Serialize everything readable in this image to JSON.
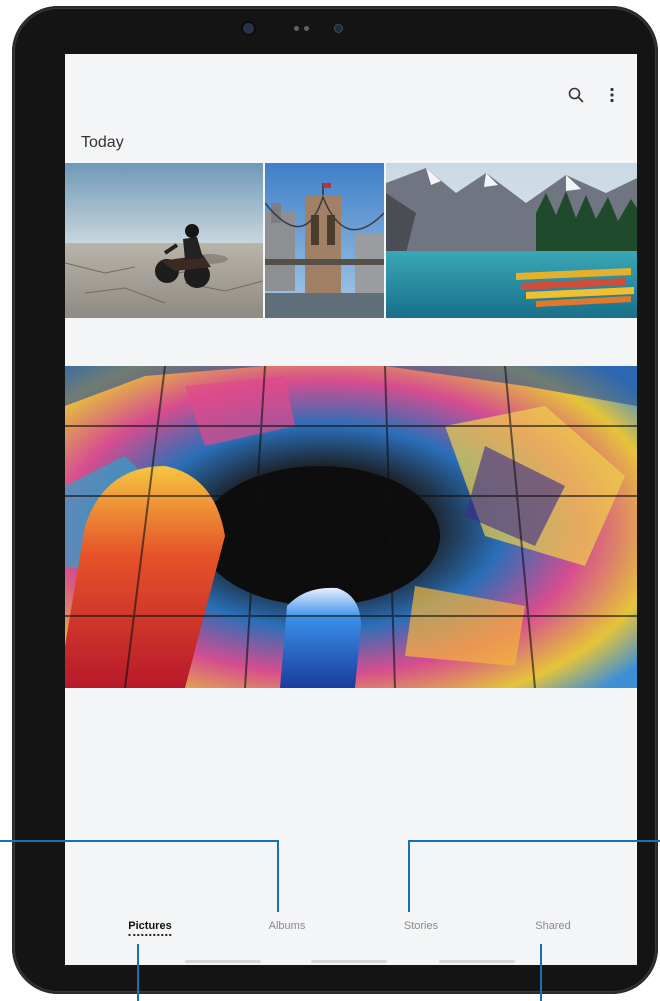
{
  "gallery": {
    "section_title": "Today",
    "photos": [
      {
        "name": "motorcycle-desert"
      },
      {
        "name": "brooklyn-bridge"
      },
      {
        "name": "mountain-lake-canoes"
      },
      {
        "name": "stained-glass-dome"
      }
    ]
  },
  "toolbar": {
    "icons": [
      "search-icon",
      "more-options-icon"
    ]
  },
  "tabs": [
    {
      "label": "Pictures",
      "active": true
    },
    {
      "label": "Albums",
      "active": false
    },
    {
      "label": "Stories",
      "active": false
    },
    {
      "label": "Shared",
      "active": false
    }
  ],
  "colors": {
    "callout_line": "#1a6fae",
    "screen_bg": "#f4f5f7",
    "device_body": "#141414"
  }
}
